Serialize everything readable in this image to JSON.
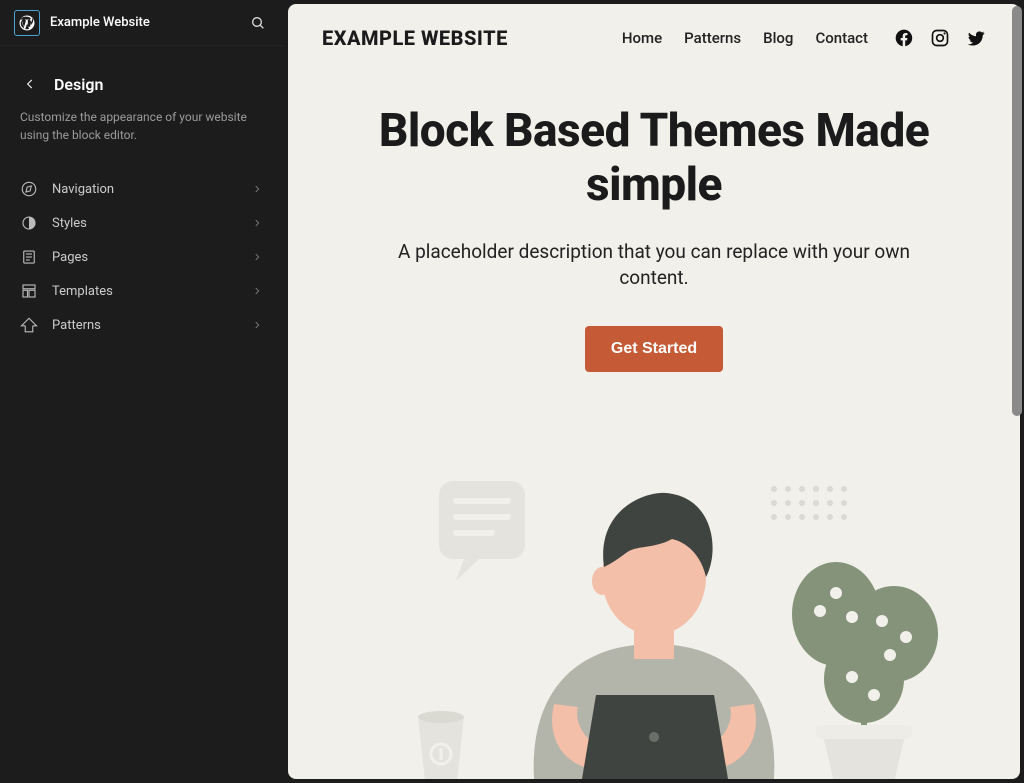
{
  "app": {
    "site_title": "Example Website"
  },
  "sidebar": {
    "panel_title": "Design",
    "panel_description": "Customize the appearance of your website using the block editor.",
    "items": [
      {
        "label": "Navigation",
        "icon": "compass-icon"
      },
      {
        "label": "Styles",
        "icon": "half-circle-icon"
      },
      {
        "label": "Pages",
        "icon": "page-icon"
      },
      {
        "label": "Templates",
        "icon": "layout-icon"
      },
      {
        "label": "Patterns",
        "icon": "patterns-icon"
      }
    ]
  },
  "preview": {
    "brand": "EXAMPLE WEBSITE",
    "nav": [
      "Home",
      "Patterns",
      "Blog",
      "Contact"
    ],
    "social": [
      "facebook",
      "instagram",
      "twitter"
    ],
    "hero": {
      "headline": "Block Based Themes Made simple",
      "subhead": "A placeholder description that you can replace with your own content.",
      "cta_label": "Get Started"
    }
  },
  "colors": {
    "accent": "#c55a36",
    "sidebar_bg": "#1c1c1c",
    "preview_bg": "#f2f0ea"
  }
}
